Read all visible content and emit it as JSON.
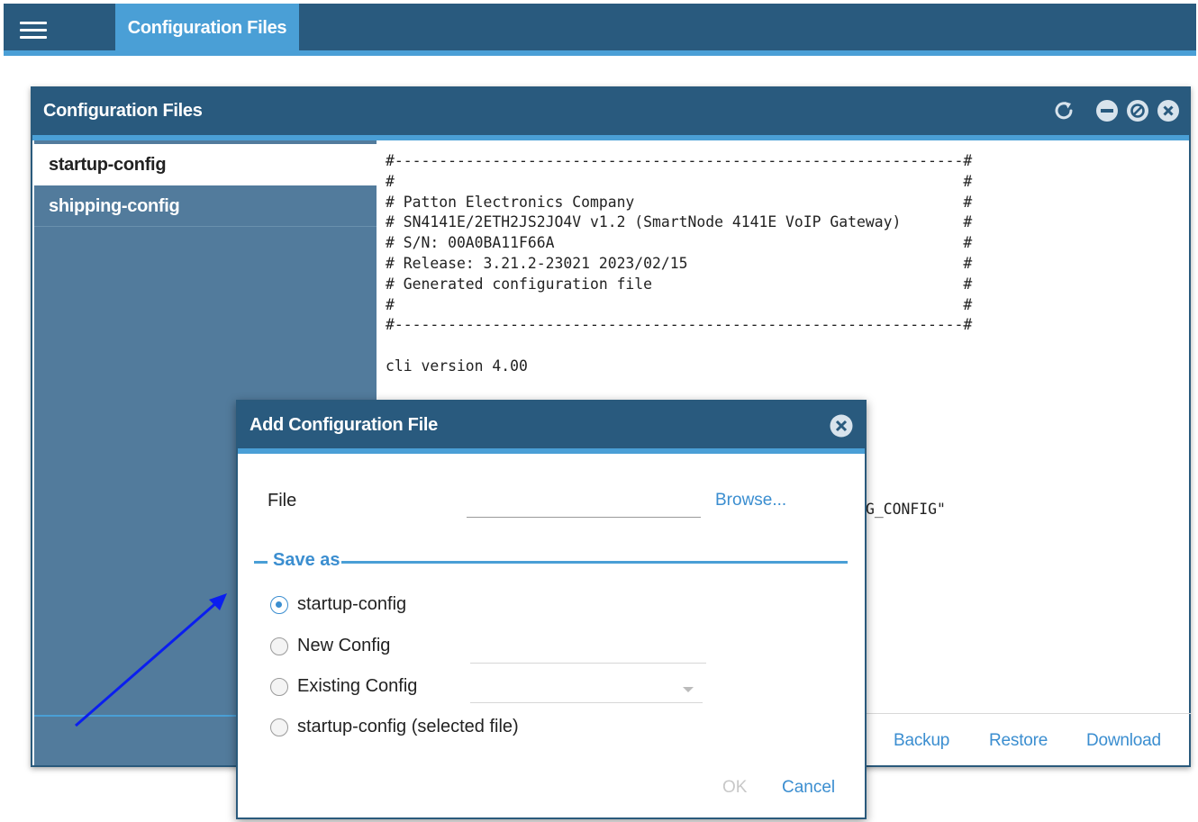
{
  "topbar": {
    "active_tab": "Configuration Files"
  },
  "panel": {
    "title": "Configuration Files",
    "icons": [
      "refresh-icon",
      "minimize-icon",
      "restore-icon",
      "close-icon"
    ],
    "files": [
      "startup-config",
      "shipping-config"
    ],
    "add_label": "+",
    "remove_label": "−",
    "config_text": "#----------------------------------------------------------------#\n#                                                                #\n# Patton Electronics Company                                     #\n# SN4141E/2ETH2JS2JO4V v1.2 (SmartNode 4141E VoIP Gateway)       #\n# S/N: 00A0BA11F66A                                              #\n# Release: 3.21.2-23021 2023/02/15                               #\n# Generated configuration file                                   #\n#                                                                #\n#----------------------------------------------------------------#\n\ncli version 4.00",
    "config_text_tail": "G_CONFIG\"",
    "actions": {
      "backup": "Backup",
      "restore": "Restore",
      "download": "Download"
    }
  },
  "dialog": {
    "title": "Add Configuration File",
    "file_label": "File",
    "file_value": "",
    "browse_label": "Browse...",
    "save_as_legend": "Save as",
    "options": [
      {
        "label": "startup-config",
        "checked": true
      },
      {
        "label": "New Config",
        "checked": false
      },
      {
        "label": "Existing Config",
        "checked": false
      },
      {
        "label": "startup-config (selected file)",
        "checked": false
      }
    ],
    "new_config_value": "",
    "existing_config_value": "",
    "ok_label": "OK",
    "cancel_label": "Cancel"
  },
  "colors": {
    "header": "#295a7e",
    "accent": "#4a9fd6",
    "link": "#3b8ed0",
    "sidebar": "#527b9c",
    "annotation_arrow": "#0a1ef0"
  }
}
